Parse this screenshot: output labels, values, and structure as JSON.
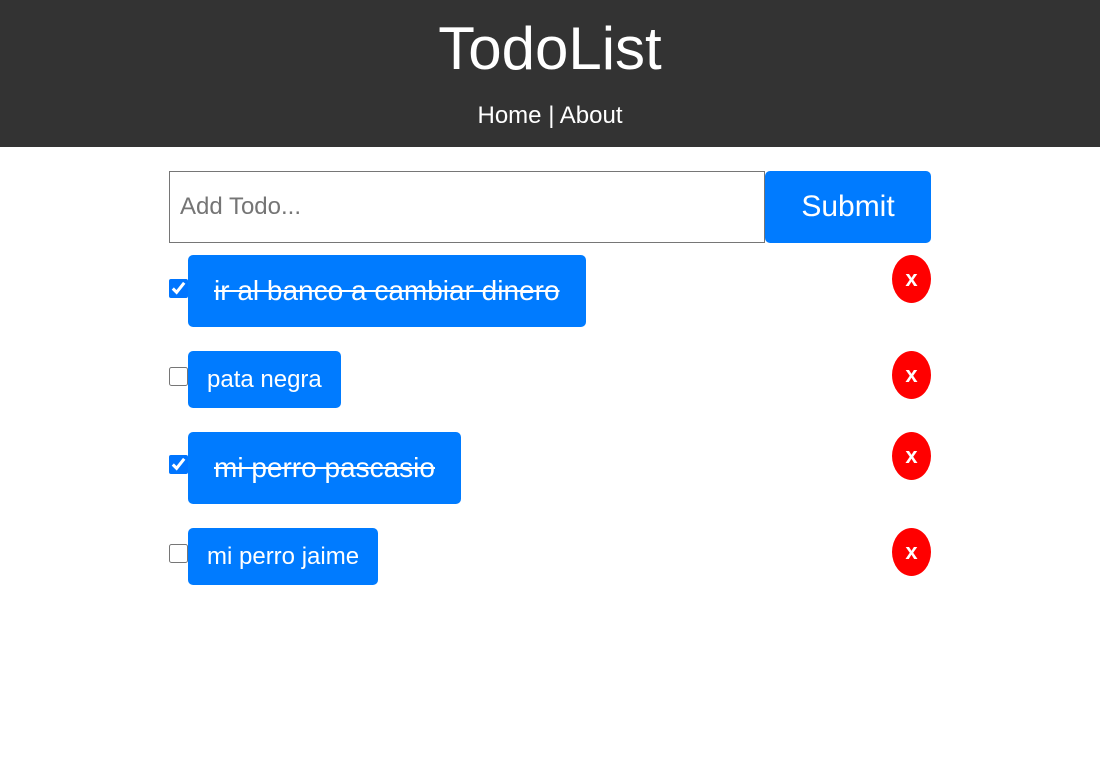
{
  "header": {
    "title": "TodoList",
    "nav_home": "Home",
    "nav_separator": " | ",
    "nav_about": "About"
  },
  "form": {
    "placeholder": "Add Todo...",
    "value": "",
    "submit_label": "Submit"
  },
  "todos": [
    {
      "text": "ir al banco a cambiar dinero",
      "completed": true,
      "delete_label": "x"
    },
    {
      "text": "pata negra",
      "completed": false,
      "delete_label": "x"
    },
    {
      "text": "mi perro pascasio",
      "completed": true,
      "delete_label": "x"
    },
    {
      "text": "mi perro jaime",
      "completed": false,
      "delete_label": "x"
    }
  ],
  "colors": {
    "header_bg": "#333333",
    "primary": "#007bff",
    "danger": "#ff0000"
  },
  "icons": {
    "checkbox": "checkbox-icon"
  }
}
